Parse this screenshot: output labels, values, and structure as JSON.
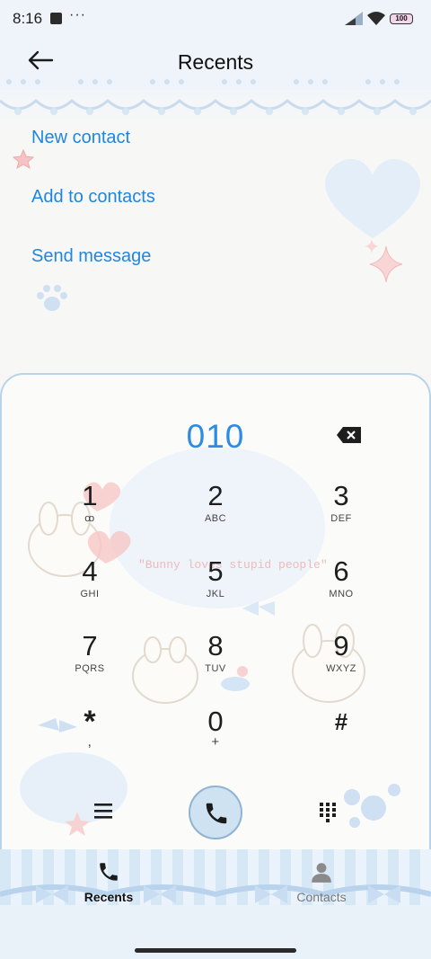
{
  "status_bar": {
    "time": "8:16",
    "more_dots": "···",
    "battery": "100",
    "icons": [
      "app-square-icon",
      "signal-icon",
      "wifi-icon",
      "battery-icon"
    ]
  },
  "header": {
    "title": "Recents",
    "back_icon": "back-arrow-icon"
  },
  "actions": [
    {
      "label": "New contact"
    },
    {
      "label": "Add to contacts"
    },
    {
      "label": "Send message"
    }
  ],
  "dialer": {
    "number": "010",
    "backspace_icon": "backspace-icon",
    "keys": [
      {
        "digit": "1",
        "letters": "ꝏ"
      },
      {
        "digit": "2",
        "letters": "ABC"
      },
      {
        "digit": "3",
        "letters": "DEF"
      },
      {
        "digit": "4",
        "letters": "GHI"
      },
      {
        "digit": "5",
        "letters": "JKL"
      },
      {
        "digit": "6",
        "letters": "MNO"
      },
      {
        "digit": "7",
        "letters": "PQRS"
      },
      {
        "digit": "8",
        "letters": "TUV"
      },
      {
        "digit": "9",
        "letters": "WXYZ"
      },
      {
        "digit": "*",
        "letters": ","
      },
      {
        "digit": "0",
        "letters": "+"
      },
      {
        "digit": "#",
        "letters": ""
      }
    ],
    "wallpaper_caption": "\"Bunny loves stupid people\""
  },
  "controls": {
    "menu_icon": "menu-icon",
    "call_icon": "phone-icon",
    "dialpad_icon": "dialpad-icon"
  },
  "nav": [
    {
      "label": "Recents",
      "icon": "phone-icon",
      "active": true
    },
    {
      "label": "Contacts",
      "icon": "person-icon",
      "active": false
    }
  ],
  "colors": {
    "accent": "#1f86e0",
    "dial_number": "#2d8be3",
    "panel_border": "#b8d3ea",
    "header_bg": "#eef4fa"
  }
}
